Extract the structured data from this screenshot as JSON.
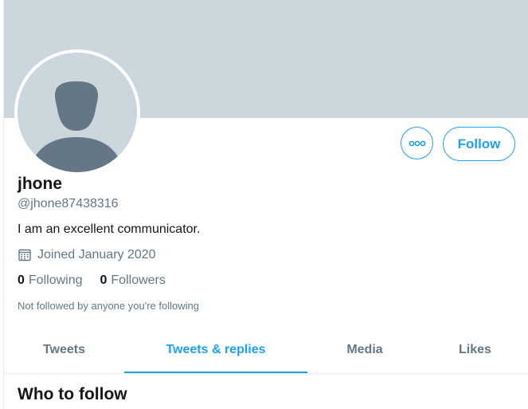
{
  "profile": {
    "display_name": "jhone",
    "handle": "@jhone87438316",
    "bio": "I am an excellent communicator.",
    "joined": "Joined January 2020",
    "following_count": "0",
    "following_label": "Following",
    "followers_count": "0",
    "followers_label": "Followers",
    "not_followed_note": "Not followed by anyone you're following"
  },
  "actions": {
    "more_icon": "more-dots-icon",
    "follow_label": "Follow"
  },
  "tabs": [
    {
      "label": "Tweets",
      "active": false
    },
    {
      "label": "Tweets & replies",
      "active": true
    },
    {
      "label": "Media",
      "active": false
    },
    {
      "label": "Likes",
      "active": false
    }
  ],
  "sidebar": {
    "who_to_follow": "Who to follow"
  },
  "colors": {
    "accent": "#1da1f2",
    "banner": "#ccd6dd",
    "avatar_placeholder": "#657786",
    "text_primary": "#14171a",
    "text_secondary": "#657786"
  },
  "icons": {
    "calendar": "calendar-icon",
    "avatar": "default-avatar-icon"
  }
}
